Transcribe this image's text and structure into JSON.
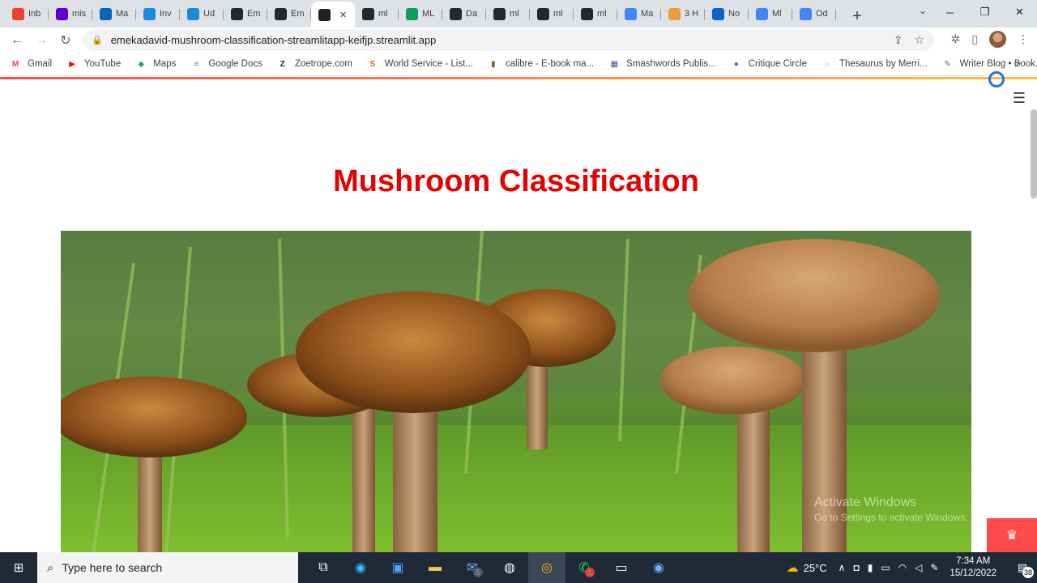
{
  "browser": {
    "tabs": [
      {
        "label": "Inb",
        "icon": "gmail-icon",
        "color": "#ea4335"
      },
      {
        "label": "mis",
        "icon": "yahoo-mail-icon",
        "color": "#6001d2"
      },
      {
        "label": "Ma",
        "icon": "outlook-icon",
        "color": "#0a64b8"
      },
      {
        "label": "Inv",
        "icon": "udemy-icon",
        "color": "#1c8adb"
      },
      {
        "label": "Ud",
        "icon": "udemy-icon",
        "color": "#1c8adb"
      },
      {
        "label": "Em",
        "icon": "github-icon",
        "color": "#24292f"
      },
      {
        "label": "Em",
        "icon": "github-icon",
        "color": "#24292f"
      },
      {
        "label": "",
        "icon": "streamlit-icon",
        "color": "#202124",
        "active": true
      },
      {
        "label": "ml",
        "icon": "github-icon",
        "color": "#24292f"
      },
      {
        "label": "ML",
        "icon": "google-sheets-icon",
        "color": "#0f9d58"
      },
      {
        "label": "Da",
        "icon": "github-icon",
        "color": "#24292f"
      },
      {
        "label": "ml",
        "icon": "github-icon",
        "color": "#24292f"
      },
      {
        "label": "ml",
        "icon": "github-icon",
        "color": "#24292f"
      },
      {
        "label": "ml",
        "icon": "github-icon",
        "color": "#24292f"
      },
      {
        "label": "Ma",
        "icon": "google-docs-icon",
        "color": "#4285f4"
      },
      {
        "label": "3 H",
        "icon": "bot-icon",
        "color": "#e8a13a"
      },
      {
        "label": "No",
        "icon": "linkedin-icon",
        "color": "#0a66c2"
      },
      {
        "label": "Ml",
        "icon": "google-docs-icon",
        "color": "#4285f4"
      },
      {
        "label": "Od",
        "icon": "google-docs-icon",
        "color": "#4285f4"
      }
    ],
    "url": "emekadavid-mushroom-classification-streamlitapp-keifjp.streamlit.app",
    "bookmarks": [
      {
        "label": "Gmail",
        "icon": "gmail-icon",
        "color": "#ea4335",
        "glyph": "M"
      },
      {
        "label": "YouTube",
        "icon": "youtube-icon",
        "color": "#ff0000",
        "glyph": "▶"
      },
      {
        "label": "Maps",
        "icon": "maps-icon",
        "color": "#34a853",
        "glyph": "◆"
      },
      {
        "label": "Google Docs",
        "icon": "google-docs-icon",
        "color": "#4285f4",
        "glyph": "≡"
      },
      {
        "label": "Zoetrope.com",
        "icon": "zoetrope-icon",
        "color": "#222222",
        "glyph": "Z"
      },
      {
        "label": "World Service - List...",
        "icon": "soundcloud-icon",
        "color": "#e2591c",
        "glyph": "S"
      },
      {
        "label": "calibre - E-book ma...",
        "icon": "calibre-icon",
        "color": "#8a5a2b",
        "glyph": "▮"
      },
      {
        "label": "Smashwords Publis...",
        "icon": "smashwords-icon",
        "color": "#3b5998",
        "glyph": "▦"
      },
      {
        "label": "Critique Circle",
        "icon": "critique-circle-icon",
        "color": "#1a73e8",
        "glyph": "●"
      },
      {
        "label": "Thesaurus by Merri...",
        "icon": "merriam-webster-icon",
        "color": "#999999",
        "glyph": "○"
      },
      {
        "label": "Writer Blog • Book...",
        "icon": "writer-blog-icon",
        "color": "#a0522d",
        "glyph": "✎"
      }
    ]
  },
  "page": {
    "title": "Mushroom Classification",
    "hero_alt_icon": "mushroom-photo",
    "watermark_title": "Activate Windows",
    "watermark_sub": "Go to Settings to activate Windows."
  },
  "taskbar": {
    "search_placeholder": "Type here to search",
    "weather_temp": "25°C",
    "time": "7:34 AM",
    "date": "15/12/2022",
    "mail_badge": "5",
    "whatsapp_badge": "1",
    "notification_count": "38"
  }
}
